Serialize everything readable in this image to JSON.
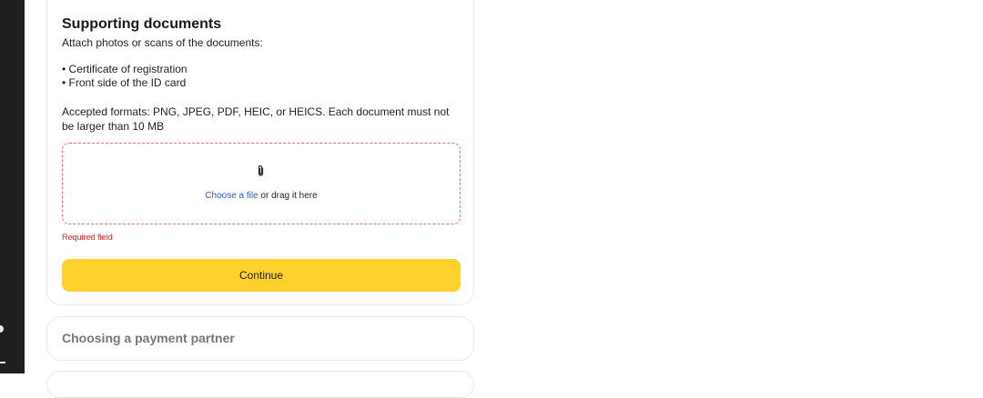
{
  "supporting_documents": {
    "title": "Supporting documents",
    "subtitle": "Attach photos or scans of the documents:",
    "documents": [
      "Certificate of registration",
      "Front side of the ID card"
    ],
    "formats_note": "Accepted formats: PNG, JPEG, PDF, HEIC, or HEICS. Each document must not be larger than 10 MB",
    "dropzone": {
      "icon": "paperclip-icon",
      "link_label": "Choose a file",
      "rest_label": " or drag it here"
    },
    "error_text": "Required field",
    "continue_label": "Continue"
  },
  "payment_partner": {
    "title": "Choosing a payment partner"
  },
  "colors": {
    "accent": "#ffd12d",
    "link": "#2f5fd0",
    "error": "#e0202b",
    "dropzone_border": "#e5737b"
  }
}
